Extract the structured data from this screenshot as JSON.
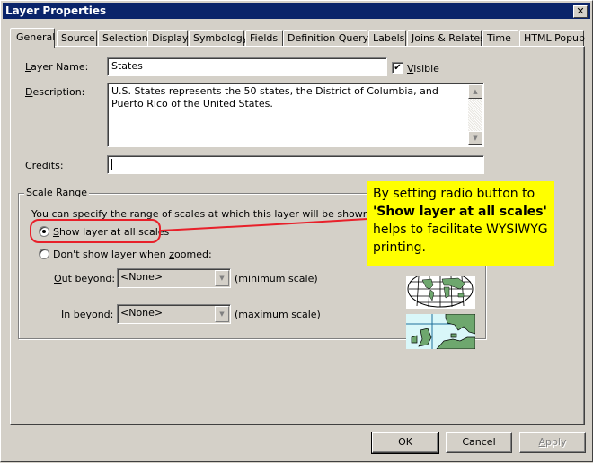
{
  "window": {
    "title": "Layer Properties",
    "close_glyph": "✕"
  },
  "tabs": [
    {
      "label": "General",
      "active": true
    },
    {
      "label": "Source"
    },
    {
      "label": "Selection"
    },
    {
      "label": "Display"
    },
    {
      "label": "Symbology"
    },
    {
      "label": "Fields"
    },
    {
      "label": "Definition Query"
    },
    {
      "label": "Labels"
    },
    {
      "label": "Joins & Relates"
    },
    {
      "label": "Time"
    },
    {
      "label": "HTML Popup"
    }
  ],
  "general": {
    "layer_name_label_key": "L",
    "layer_name_label_rest": "ayer Name:",
    "layer_name_value": "States",
    "visible_label_key": "V",
    "visible_label_rest": "isible",
    "visible_checked": true,
    "check_glyph": "✔",
    "description_label_key": "D",
    "description_label_rest": "escription:",
    "description_value": "U.S. States represents the 50 states, the District of Columbia, and Puerto Rico of the United States.",
    "credits_label_pre": "Cr",
    "credits_label_key": "e",
    "credits_label_rest": "dits:",
    "credits_value": "",
    "scroll_up_glyph": "▲",
    "scroll_down_glyph": "▼"
  },
  "scale_range": {
    "title": "Scale Range",
    "instruction": "You can specify the range of scales at which this layer will be shown:",
    "option_all_key": "S",
    "option_all_rest": "how layer at all scales",
    "option_all_selected": true,
    "option_zoom_pre": "Don't show layer when ",
    "option_zoom_key": "z",
    "option_zoom_rest": "oomed:",
    "out_beyond_key": "O",
    "out_beyond_rest": "ut beyond:",
    "out_beyond_value": "<None>",
    "out_beyond_hint": "(minimum scale)",
    "in_beyond_key": "I",
    "in_beyond_rest": "n beyond:",
    "in_beyond_value": "<None>",
    "in_beyond_hint": "(maximum scale)",
    "dropdown_glyph": "▼"
  },
  "annotation": {
    "line1": "By setting radio button to",
    "line2_bold": "'Show layer at all scales'",
    "line3": "helps to facilitate WYSIWYG",
    "line4": "printing.",
    "background_color": "#ffff00",
    "highlight_color": "#e8202a"
  },
  "buttons": {
    "ok": "OK",
    "cancel": "Cancel",
    "apply_key": "A",
    "apply_rest": "pply",
    "apply_disabled": true
  }
}
